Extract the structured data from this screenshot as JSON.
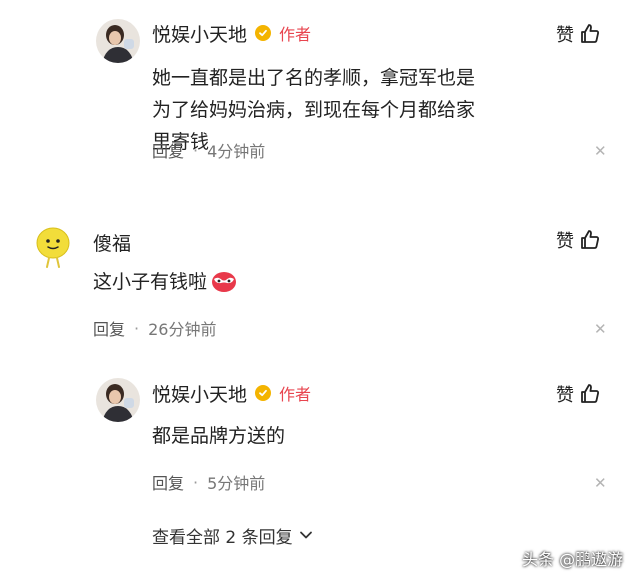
{
  "comments": [
    {
      "author": "悦娱小天地",
      "author_tag": "作者",
      "like_label": "赞",
      "text": "她一直都是出了名的孝顺，拿冠军也是为了给妈妈治病，到现在每个月都给家里寄钱",
      "reply_label": "回复",
      "separator": "·",
      "time": "4分钟前"
    },
    {
      "author": "傻福",
      "like_label": "赞",
      "text": "这小子有钱啦",
      "reply_label": "回复",
      "separator": "·",
      "time": "26分钟前"
    },
    {
      "author": "悦娱小天地",
      "author_tag": "作者",
      "like_label": "赞",
      "text": "都是品牌方送的",
      "reply_label": "回复",
      "separator": "·",
      "time": "5分钟前"
    }
  ],
  "view_all_replies": "查看全部 2 条回复",
  "watermark": "头条 @鹏遨游",
  "colors": {
    "author_tag": "#e8454f",
    "verified_badge": "#f4b400",
    "meta_text": "#777777"
  }
}
